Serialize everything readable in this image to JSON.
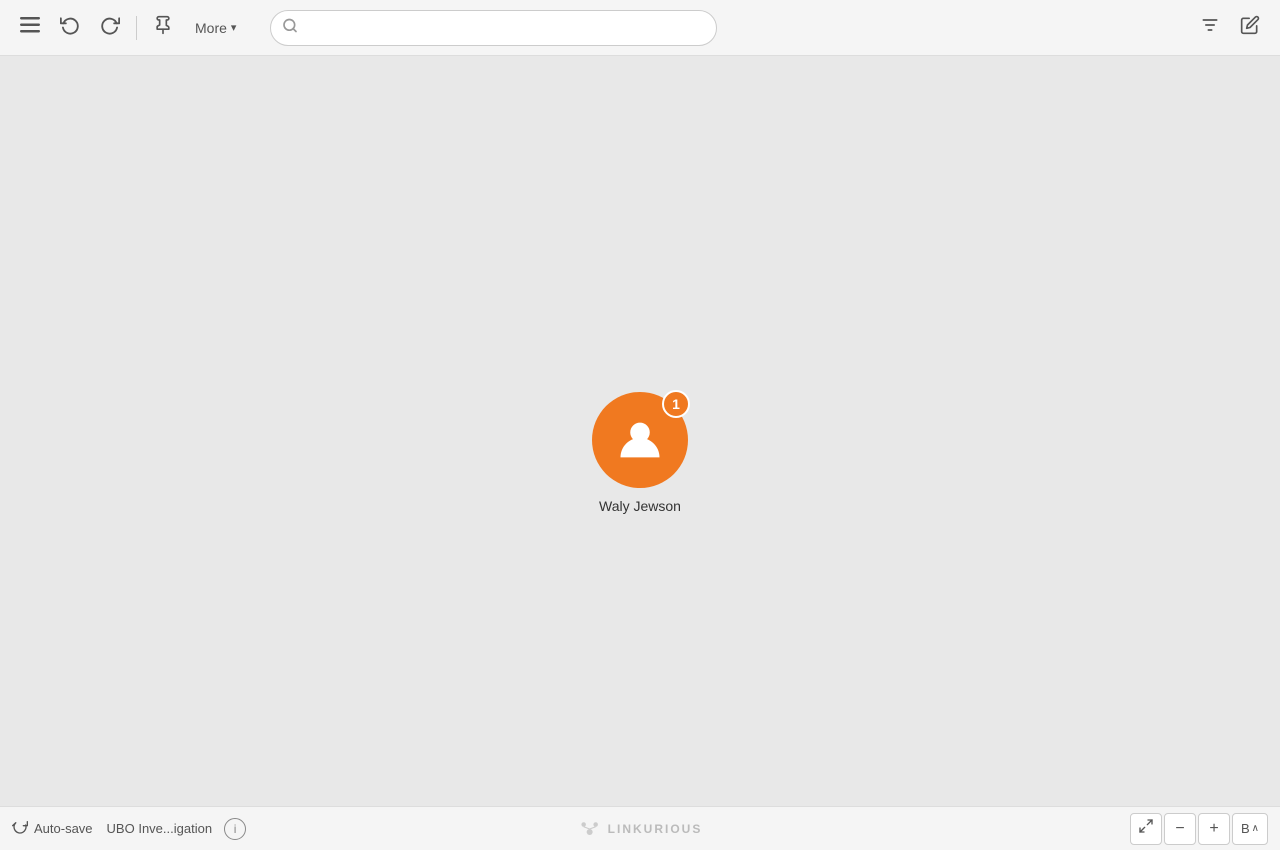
{
  "toolbar": {
    "menu_icon": "☰",
    "undo_icon": "↩",
    "redo_icon": "↪",
    "pin_icon": "✏",
    "more_label": "More",
    "chevron_down": "▾",
    "search_placeholder": "",
    "filter_icon": "filter",
    "edit_icon": "pencil"
  },
  "node": {
    "label": "Waly Jewson",
    "badge_count": "1",
    "color": "#f07920"
  },
  "bottom_bar": {
    "autosave_label": "Auto-save",
    "investigation_name": "UBO Inve...igation",
    "info_icon": "i",
    "logo_text": "LINKURIOUS",
    "zoom_out": "−",
    "zoom_in": "+",
    "zoom_fit_label": "B",
    "zoom_fit_chevron": "∧",
    "fullscreen_icon": "⛶"
  }
}
